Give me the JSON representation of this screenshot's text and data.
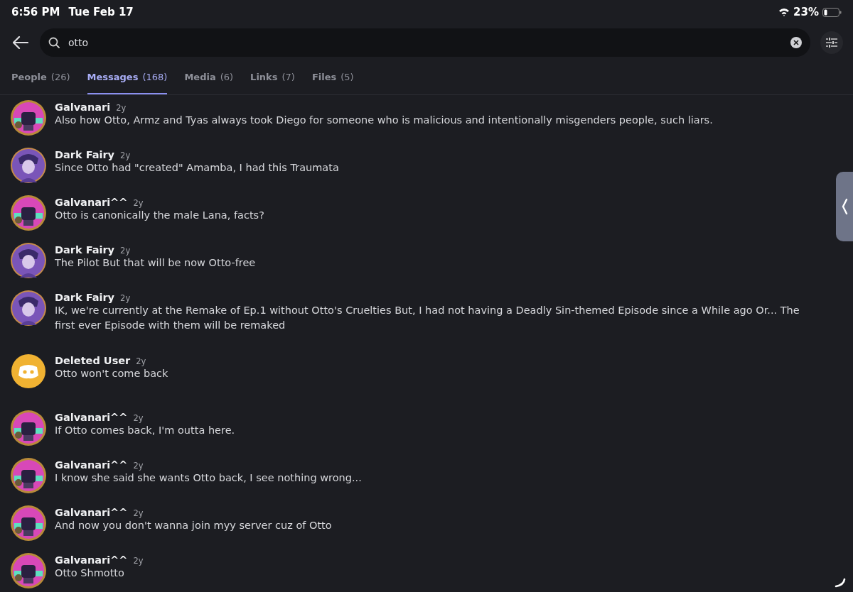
{
  "status_bar": {
    "time": "6:56 PM",
    "date": "Tue Feb 17",
    "battery": "23%"
  },
  "search": {
    "value": "otto"
  },
  "tabs": [
    {
      "label": "People",
      "count": "(26)",
      "selected": false
    },
    {
      "label": "Messages",
      "count": "(168)",
      "selected": true
    },
    {
      "label": "Media",
      "count": "(6)",
      "selected": false
    },
    {
      "label": "Links",
      "count": "(7)",
      "selected": false
    },
    {
      "label": "Files",
      "count": "(5)",
      "selected": false
    }
  ],
  "messages": [
    {
      "author": "Galvanari",
      "time": "2y",
      "kind": "pink",
      "text": "Also how Otto, Armz and Tyas always took Diego for someone who is malicious and intentionally misgenders people, such liars."
    },
    {
      "author": "Dark Fairy",
      "time": "2y",
      "kind": "purple",
      "text": "Since Otto had \"created\" Amamba, I had this Traumata"
    },
    {
      "author": "Galvanari^^",
      "time": "2y",
      "kind": "pink",
      "text": "Otto is canonically the male Lana, facts?"
    },
    {
      "author": "Dark Fairy",
      "time": "2y",
      "kind": "purple",
      "text": "The Pilot But that will be now Otto-free"
    },
    {
      "author": "Dark Fairy",
      "time": "2y",
      "kind": "purple",
      "text": "IK, we're currently at the Remake of Ep.1 without Otto's Cruelties But, I had not having a Deadly Sin-themed Episode since a While ago Or... The first ever Episode with them will be remaked"
    },
    {
      "author": "Deleted User",
      "time": "2y",
      "kind": "deleted",
      "text": "Otto won't come back"
    },
    {
      "author": "Galvanari^^",
      "time": "2y",
      "kind": "pink",
      "text": "If Otto comes back, I'm outta here."
    },
    {
      "author": "Galvanari^^",
      "time": "2y",
      "kind": "pink",
      "text": "I know she said she wants Otto back, I see nothing wrong..."
    },
    {
      "author": "Galvanari^^",
      "time": "2y",
      "kind": "pink",
      "text": "And now you don't wanna join myy server cuz of Otto"
    },
    {
      "author": "Galvanari^^",
      "time": "2y",
      "kind": "pink",
      "text": "Otto Shmotto"
    }
  ]
}
